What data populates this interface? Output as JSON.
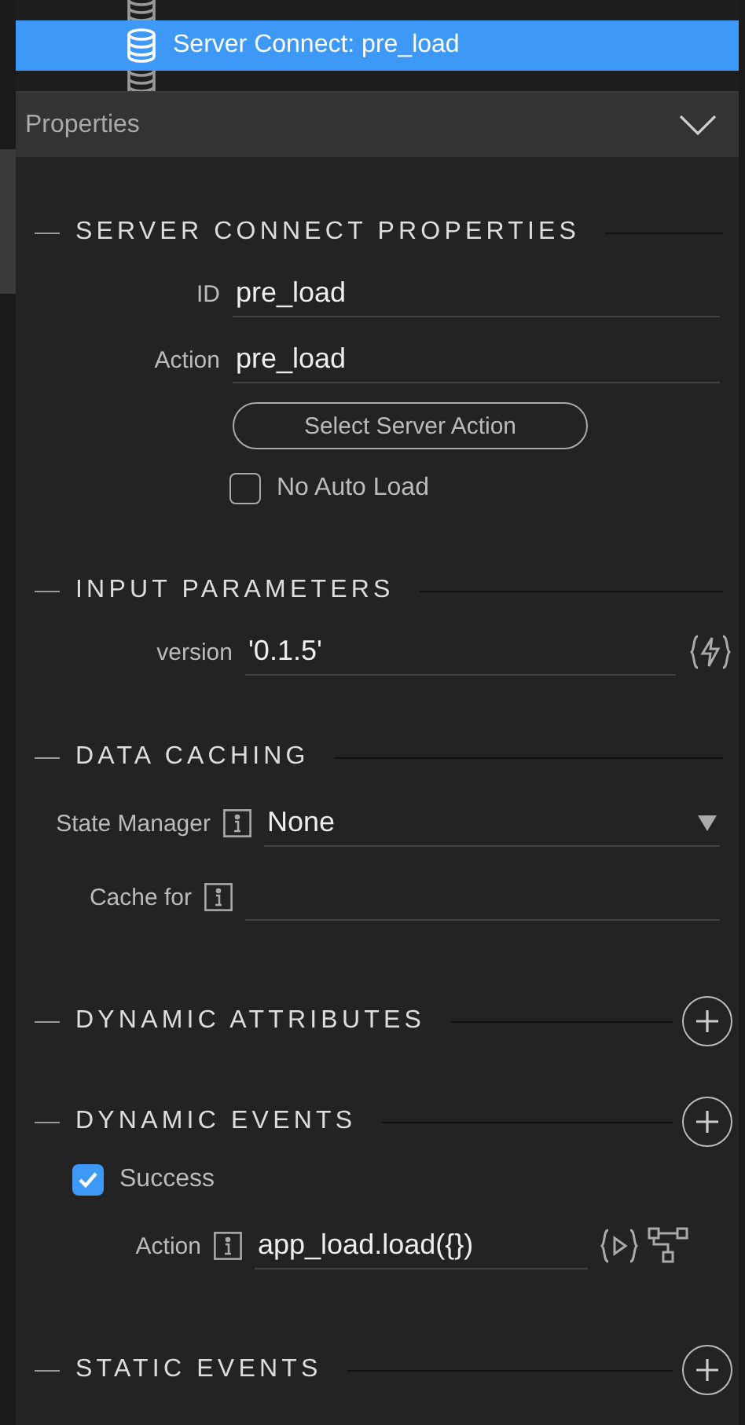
{
  "tree": {
    "items": [
      {
        "selected": false
      },
      {
        "label": "Server Connect: pre_load",
        "selected": true
      },
      {
        "selected": false
      }
    ]
  },
  "panel": {
    "title": "Properties",
    "expanded": true
  },
  "sections": [
    {
      "title": "SERVER CONNECT PROPERTIES",
      "addable": false,
      "fields": [
        {
          "kind": "text",
          "label": "ID",
          "value": "pre_load"
        },
        {
          "kind": "text",
          "label": "Action",
          "value": "pre_load"
        },
        {
          "kind": "button",
          "label": "Select Server Action"
        },
        {
          "kind": "checkbox",
          "label": "No Auto Load",
          "checked": false
        }
      ]
    },
    {
      "title": "INPUT PARAMETERS",
      "addable": false,
      "fields": [
        {
          "kind": "param",
          "label": "version",
          "value": "'0.1.5'"
        }
      ]
    },
    {
      "title": "DATA CACHING",
      "addable": false,
      "fields": [
        {
          "kind": "select",
          "label": "State Manager",
          "value": "None"
        },
        {
          "kind": "info",
          "label": "Cache for"
        }
      ]
    },
    {
      "title": "DYNAMIC ATTRIBUTES",
      "addable": true
    },
    {
      "title": "DYNAMIC EVENTS",
      "addable": true,
      "fields": [
        {
          "kind": "checkbox",
          "label": "Success",
          "checked": true
        },
        {
          "kind": "event",
          "label": "Action",
          "value": "app_load.load({})"
        }
      ]
    },
    {
      "title": "STATIC EVENTS",
      "addable": true
    }
  ]
}
